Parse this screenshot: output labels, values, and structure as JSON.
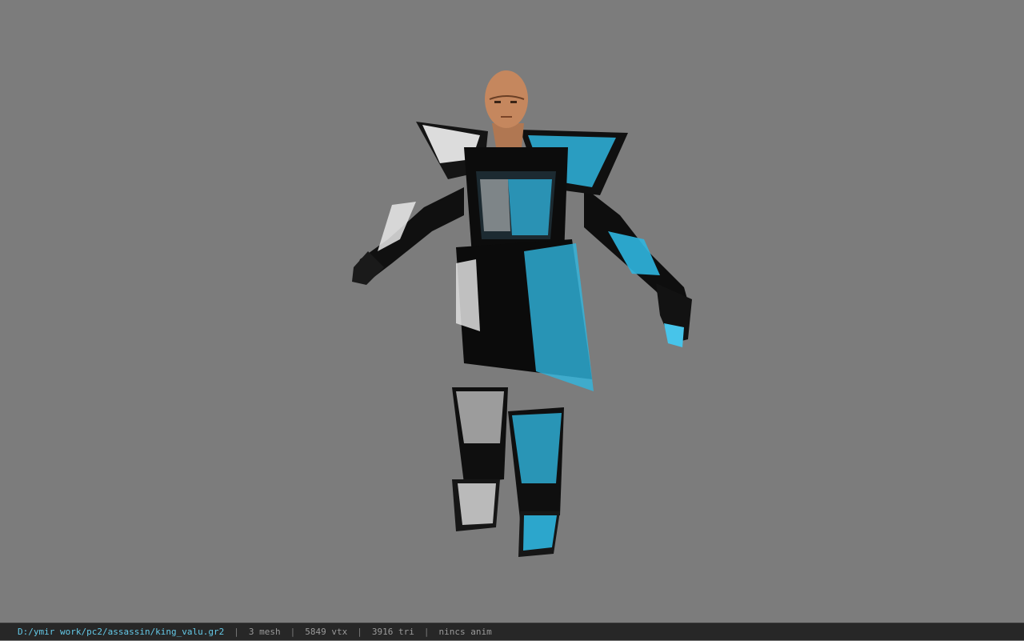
{
  "viewer": {
    "background_color": "#7c7c7c",
    "model_icon": "character-model-3d-icon",
    "accent_color": "#2fb6e0"
  },
  "status": {
    "file_path": "D:/ymir work/pc2/assassin/king_valu.gr2",
    "separator": "|",
    "mesh_count": "3 mesh",
    "vertex_count": "5849 vtx",
    "triangle_count": "3916 tri",
    "anim_state": "nincs anim"
  }
}
